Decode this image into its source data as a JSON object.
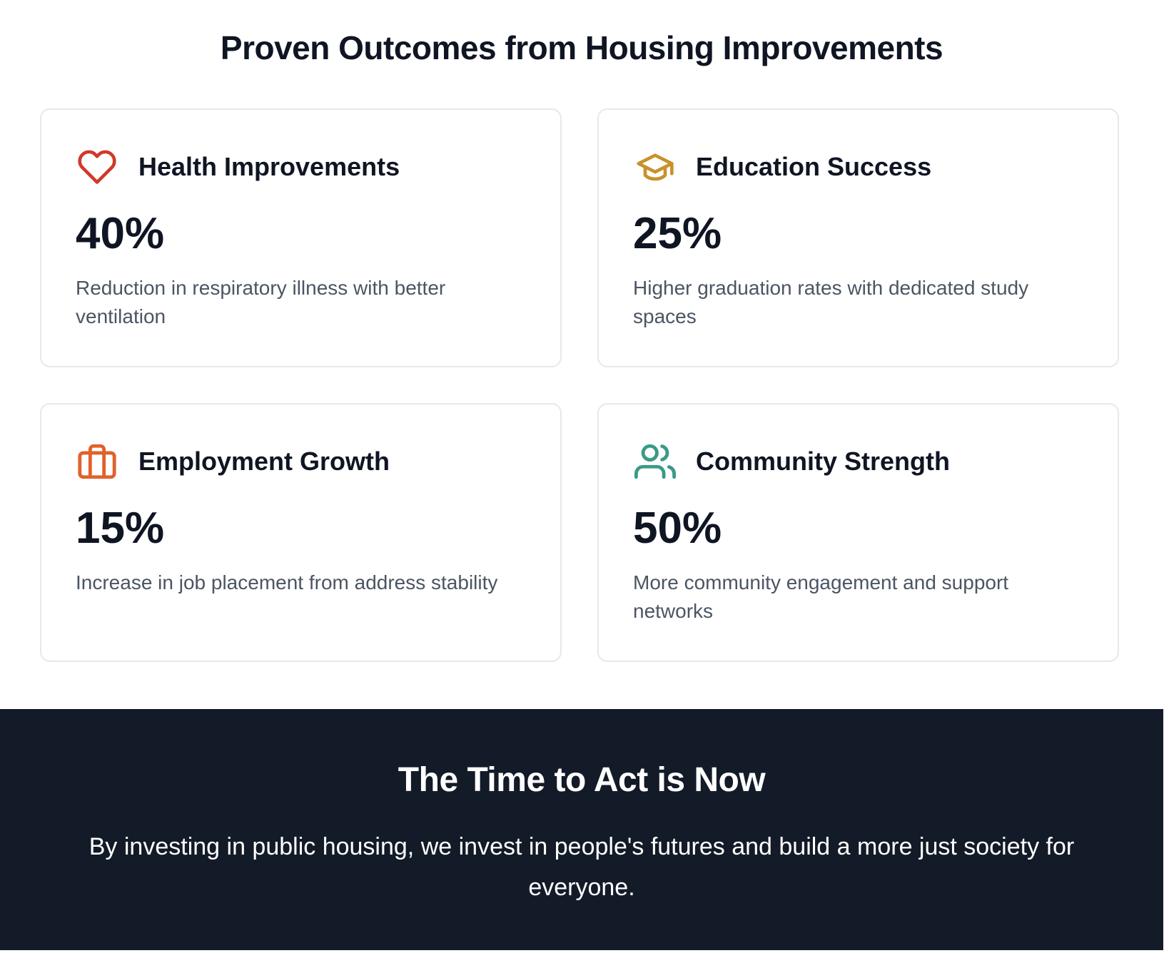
{
  "outcomes": {
    "title": "Proven Outcomes from Housing Improvements",
    "cards": [
      {
        "icon": "heart-icon",
        "icon_color": "#d0392b",
        "title": "Health Improvements",
        "stat": "40%",
        "description": "Reduction in respiratory illness with better ventilation"
      },
      {
        "icon": "graduation-cap-icon",
        "icon_color": "#c8922a",
        "title": "Education Success",
        "stat": "25%",
        "description": "Higher graduation rates with dedicated study spaces"
      },
      {
        "icon": "briefcase-icon",
        "icon_color": "#e0622a",
        "title": "Employment Growth",
        "stat": "15%",
        "description": "Increase in job placement from address stability"
      },
      {
        "icon": "users-icon",
        "icon_color": "#3a9a86",
        "title": "Community Strength",
        "stat": "50%",
        "description": "More community engagement and support networks"
      }
    ]
  },
  "cta": {
    "title": "The Time to Act is Now",
    "text": "By investing in public housing, we invest in people's futures and build a more just society for everyone.",
    "background_color": "#131a28"
  }
}
